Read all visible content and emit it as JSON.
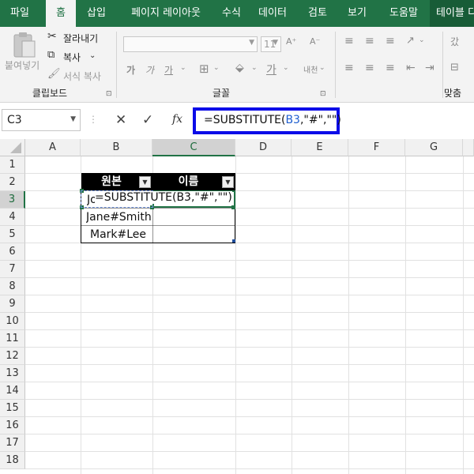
{
  "ribbon_tabs": [
    "파일",
    "홈",
    "삽입",
    "페이지 레이아웃",
    "수식",
    "데이터",
    "검토",
    "보기",
    "도움말",
    "테이블 디"
  ],
  "active_tab": "홈",
  "clipboard": {
    "paste_label": "붙여넣기",
    "cut_label": "잘라내기",
    "copy_label": "복사",
    "format_painter_label": "서식 복사",
    "group_label": "클립보드"
  },
  "font": {
    "font_name": "",
    "font_size": "11",
    "group_label": "글꼴",
    "increase_label": "가",
    "decrease_label": "가",
    "phonetic_label": "내천"
  },
  "alignment": {
    "group_label": "맞춤",
    "wrap_label": "갔"
  },
  "formula_bar": {
    "name_box": "C3",
    "cancel_icon": "✕",
    "enter_icon": "✓",
    "fx_label": "fx",
    "formula_prefix": "=SUBSTITUTE(",
    "formula_ref": "B3",
    "formula_suffix": ",\"#\",\"\")"
  },
  "columns": [
    "A",
    "B",
    "C",
    "D",
    "E",
    "F",
    "G"
  ],
  "selected_column": "C",
  "rows": [
    "1",
    "2",
    "3",
    "4",
    "5",
    "6",
    "7",
    "8",
    "9",
    "10",
    "11",
    "12",
    "13",
    "14",
    "15",
    "16",
    "17",
    "18"
  ],
  "selected_row": "3",
  "table": {
    "headers": [
      "원본",
      "이름"
    ],
    "b_cells": [
      "Jo",
      "Jane#Smith",
      "Mark#Lee"
    ],
    "editing_text": "=SUBSTITUTE(B3,\"#\",\"\")",
    "filter_icon": "▼"
  },
  "colors": {
    "accent": "#217346",
    "highlight_border": "#0c0ce8"
  }
}
